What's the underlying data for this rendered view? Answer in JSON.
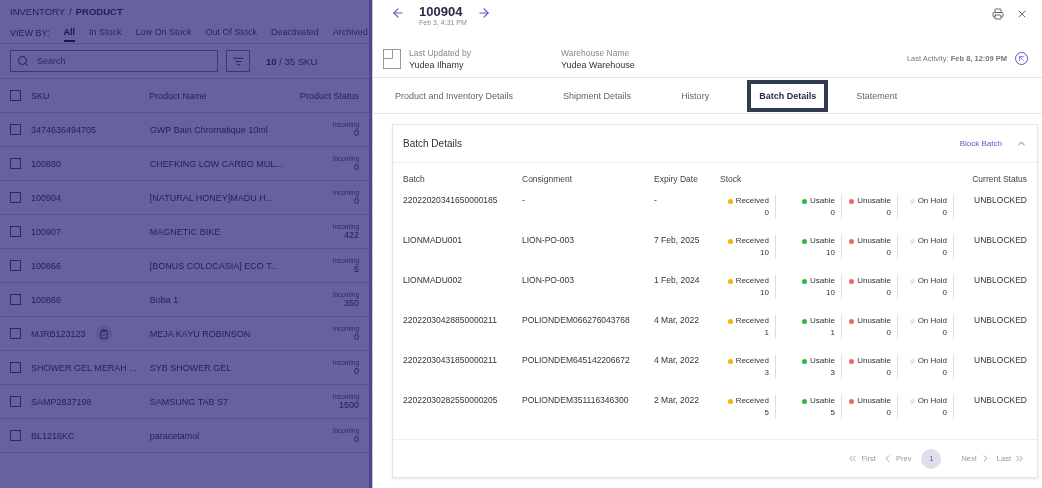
{
  "product_list": {
    "breadcrumb": {
      "parent": "INVENTORY",
      "separator": "/",
      "current": "PRODUCT"
    },
    "view_by": {
      "label": "VIEW BY:",
      "filters": [
        {
          "label": "All",
          "selected": true
        },
        {
          "label": "In Stock",
          "selected": false
        },
        {
          "label": "Low On Stock",
          "selected": false
        },
        {
          "label": "Out Of Stock",
          "selected": false
        },
        {
          "label": "Deactivated",
          "selected": false
        },
        {
          "label": "Archived",
          "selected": false
        }
      ]
    },
    "search": {
      "placeholder": "Search"
    },
    "sku_count": "**10** / 35 SKU",
    "select_all": {
      "checked": false
    },
    "columns": [
      "SKU",
      "Product Name",
      "Product Status"
    ],
    "rows": [
      {
        "sku": "3474636494705",
        "name": "GWP Bain Chromatique 10ml",
        "status_label": "Incoming",
        "status_value": "0",
        "checked": false,
        "note": false
      },
      {
        "sku": "100880",
        "name": "CHEFKING LOW CARBO MUL...",
        "status_label": "Incoming",
        "status_value": "0",
        "checked": false,
        "note": false
      },
      {
        "sku": "100904",
        "name": "[NATURAL HONEY]MADU H...",
        "status_label": "Incoming",
        "status_value": "0",
        "checked": false,
        "note": false
      },
      {
        "sku": "100907",
        "name": "MAGNETIC BIKE",
        "status_label": "Incoming",
        "status_value": "422",
        "checked": false,
        "note": false
      },
      {
        "sku": "100866",
        "name": "[BONUS COLOCASIA] ECO T...",
        "status_label": "Incoming",
        "status_value": "5",
        "checked": false,
        "note": false
      },
      {
        "sku": "100866",
        "name": "Boba 1",
        "status_label": "Incoming",
        "status_value": "350",
        "checked": false,
        "note": false
      },
      {
        "sku": "MJRB123123",
        "name": "MEJA KAYU ROBINSON",
        "status_label": "Incoming",
        "status_value": "0",
        "checked": false,
        "note": true
      },
      {
        "sku": "SHOWER GEL MERAH ...",
        "name": "SYB SHOWER GEL",
        "status_label": "Incoming",
        "status_value": "0",
        "checked": false,
        "note": false
      },
      {
        "sku": "SAMP2837198",
        "name": "SAMSUNG TAB S7",
        "status_label": "Incoming",
        "status_value": "1500",
        "checked": false,
        "note": false
      },
      {
        "sku": "BL1216KC",
        "name": "paracetamol",
        "status_label": "Incoming",
        "status_value": "0",
        "checked": false,
        "note": false
      }
    ]
  },
  "detail": {
    "title": "100904",
    "timestamp": "Feb 3, 4:31 PM",
    "last_updated": {
      "label": "Last Updated by",
      "value": "Yudea Ilhamy"
    },
    "warehouse": {
      "label": "Warehouse Name",
      "value": "Yudea Warehouse"
    },
    "last_activity": {
      "label": "Last Activity:",
      "value": "Feb 8, 12:09 PM"
    },
    "tabs": [
      {
        "label": "Product and Inventory Details",
        "selected": false
      },
      {
        "label": "Shipment Details",
        "selected": false
      },
      {
        "label": "History",
        "selected": false
      },
      {
        "label": "Batch Details",
        "selected": true
      },
      {
        "label": "Statement",
        "selected": false
      }
    ],
    "batch": {
      "title": "Batch Details",
      "action": "Block Batch",
      "expanded": true,
      "columns": [
        "Batch",
        "Consignment",
        "Expiry Date",
        "Stock",
        "Current Status"
      ],
      "rows": [
        {
          "batch": "22022020341650000185",
          "consignment": "-",
          "expiry": "-",
          "status": "UNBLOCKED",
          "stock": [
            {
              "label": "Received",
              "value": "0",
              "color": "#f5b400"
            },
            {
              "label": "Usable",
              "value": "0",
              "color": "#2eb84b"
            },
            {
              "label": "Unusable",
              "value": "0",
              "color": "#f0606a"
            },
            {
              "label": "On Hold",
              "value": "0",
              "color": "#e4e4f4"
            }
          ]
        },
        {
          "batch": "LIONMADU001",
          "consignment": "LION-PO-003",
          "expiry": "7 Feb, 2025",
          "status": "UNBLOCKED",
          "stock": [
            {
              "label": "Received",
              "value": "10",
              "color": "#f5b400"
            },
            {
              "label": "Usable",
              "value": "10",
              "color": "#2eb84b"
            },
            {
              "label": "Unusable",
              "value": "0",
              "color": "#f0606a"
            },
            {
              "label": "On Hold",
              "value": "0",
              "color": "#e4e4f4"
            }
          ]
        },
        {
          "batch": "LIONMADU002",
          "consignment": "LION-PO-003",
          "expiry": "1 Feb, 2024",
          "status": "UNBLOCKED",
          "stock": [
            {
              "label": "Received",
              "value": "10",
              "color": "#f5b400"
            },
            {
              "label": "Usable",
              "value": "10",
              "color": "#2eb84b"
            },
            {
              "label": "Unusable",
              "value": "0",
              "color": "#f0606a"
            },
            {
              "label": "On Hold",
              "value": "0",
              "color": "#e4e4f4"
            }
          ]
        },
        {
          "batch": "22022030428850000211",
          "consignment": "POLIONDEM066276043768",
          "expiry": "4 Mar, 2022",
          "status": "UNBLOCKED",
          "stock": [
            {
              "label": "Received",
              "value": "1",
              "color": "#f5b400"
            },
            {
              "label": "Usable",
              "value": "1",
              "color": "#2eb84b"
            },
            {
              "label": "Unusable",
              "value": "0",
              "color": "#f0606a"
            },
            {
              "label": "On Hold",
              "value": "0",
              "color": "#e4e4f4"
            }
          ]
        },
        {
          "batch": "22022030431850000211",
          "consignment": "POLIONDEM645142206672",
          "expiry": "4 Mar, 2022",
          "status": "UNBLOCKED",
          "stock": [
            {
              "label": "Received",
              "value": "3",
              "color": "#f5b400"
            },
            {
              "label": "Usable",
              "value": "3",
              "color": "#2eb84b"
            },
            {
              "label": "Unusable",
              "value": "0",
              "color": "#f0606a"
            },
            {
              "label": "On Hold",
              "value": "0",
              "color": "#e4e4f4"
            }
          ]
        },
        {
          "batch": "22022030282550000205",
          "consignment": "POLIONDEM351116346300",
          "expiry": "2 Mar, 2022",
          "status": "UNBLOCKED",
          "stock": [
            {
              "label": "Received",
              "value": "5",
              "color": "#f5b400"
            },
            {
              "label": "Usable",
              "value": "5",
              "color": "#2eb84b"
            },
            {
              "label": "Unusable",
              "value": "0",
              "color": "#f0606a"
            },
            {
              "label": "On Hold",
              "value": "0",
              "color": "#e4e4f4"
            }
          ]
        }
      ],
      "pagination": {
        "first": "First",
        "prev": "Prev",
        "pages": [
          {
            "label": "1",
            "selected": true
          }
        ],
        "next": "Next",
        "last": "Last"
      }
    }
  }
}
